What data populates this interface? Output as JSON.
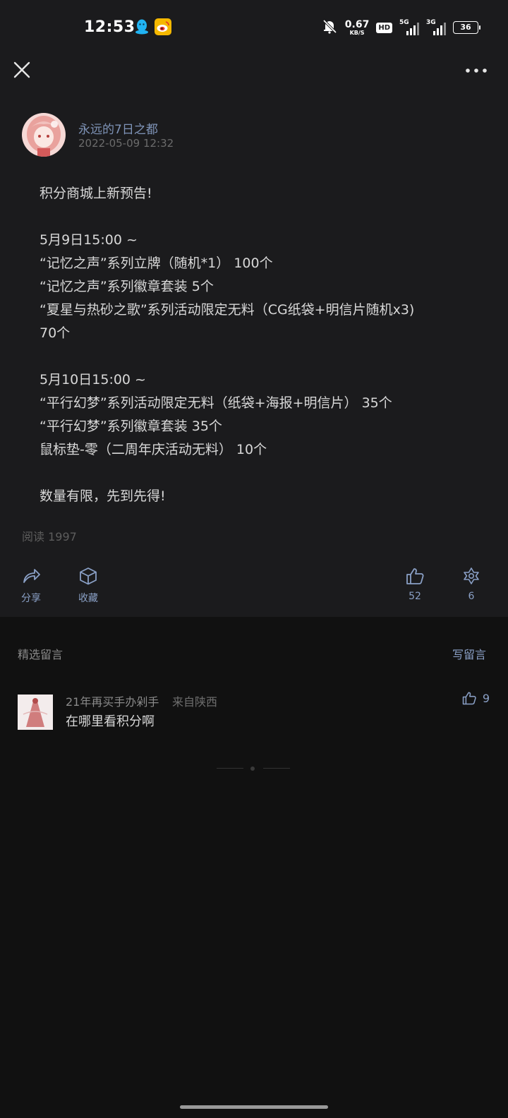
{
  "status_bar": {
    "time": "12:53",
    "app_icons": [
      "qq-icon",
      "weibo-icon"
    ],
    "net_speed_value": "0.67",
    "net_speed_unit": "KB/S",
    "hd_label": "HD",
    "signal_1_label": "5G",
    "signal_2_label": "3G",
    "battery_level": "36"
  },
  "toolbar": {
    "close_icon": "close-icon",
    "more_icon": "more-dots-icon"
  },
  "post": {
    "author": "永远的7日之都",
    "timestamp": "2022-05-09 12:32",
    "lines": [
      "积分商城上新预告!",
      "",
      "5月9日15:00 ~",
      "“记忆之声”系列立牌（随机*1） 100个",
      "“记忆之声”系列徽章套装 5个",
      "“夏星与热砂之歌”系列活动限定无料（CG纸袋+明信片随机x3)",
      "70个",
      "",
      "5月10日15:00 ~",
      "“平行幻梦”系列活动限定无料（纸袋+海报+明信片） 35个",
      "“平行幻梦”系列徽章套装 35个",
      "鼠标垫-零（二周年庆活动无料） 10个",
      "",
      "数量有限，先到先得!"
    ],
    "read_count": "阅读 1997"
  },
  "actions": {
    "share_label": "分享",
    "collect_label": "收藏",
    "like_count": "52",
    "recommend_count": "6"
  },
  "comments": {
    "section_title": "精选留言",
    "write_label": "写留言",
    "items": [
      {
        "author": "21年再买手办剁手",
        "location": "来自陕西",
        "text": "在哪里看积分啊",
        "likes": "9"
      }
    ]
  },
  "colors": {
    "accent": "#8aa0c6",
    "author_name": "#7f94b8",
    "card_bg": "#1b1b1d",
    "page_bg": "#111111"
  }
}
